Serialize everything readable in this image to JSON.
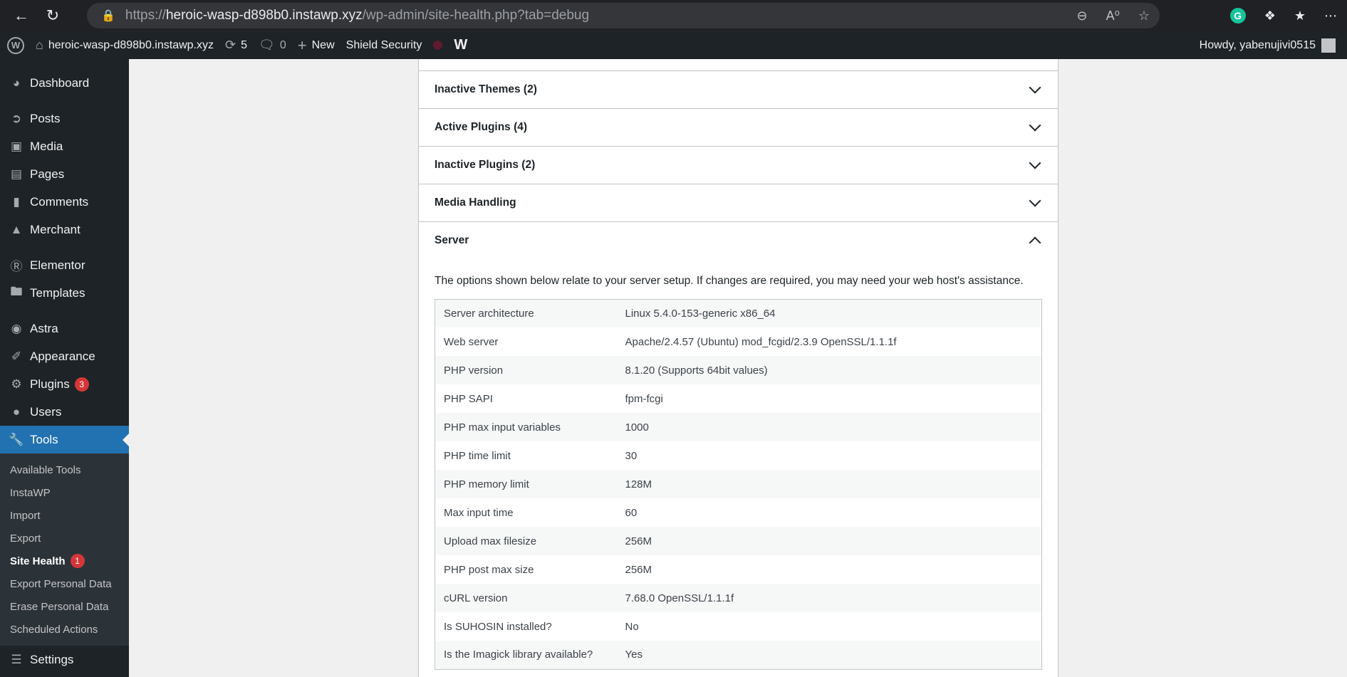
{
  "browser": {
    "url_prefix": "https://",
    "url_host": "heroic-wasp-d898b0.instawp.xyz",
    "url_path": "/wp-admin/site-health.php?tab=debug"
  },
  "adminbar": {
    "site_name": "heroic-wasp-d898b0.instawp.xyz",
    "updates_count": "5",
    "comments_count": "0",
    "new_label": "New",
    "shield_label": "Shield Security",
    "howdy": "Howdy, yabenujivi0515"
  },
  "sidebar": {
    "dashboard": "Dashboard",
    "posts": "Posts",
    "media": "Media",
    "pages": "Pages",
    "comments": "Comments",
    "merchant": "Merchant",
    "elementor": "Elementor",
    "templates": "Templates",
    "astra": "Astra",
    "appearance": "Appearance",
    "plugins": "Plugins",
    "plugins_badge": "3",
    "users": "Users",
    "tools": "Tools",
    "settings": "Settings",
    "tools_sub": {
      "available_tools": "Available Tools",
      "instawp": "InstaWP",
      "import": "Import",
      "export": "Export",
      "site_health": "Site Health",
      "site_health_badge": "1",
      "export_personal": "Export Personal Data",
      "erase_personal": "Erase Personal Data",
      "scheduled_actions": "Scheduled Actions"
    }
  },
  "accordions": {
    "inactive_themes": "Inactive Themes (2)",
    "active_plugins": "Active Plugins (4)",
    "inactive_plugins": "Inactive Plugins (2)",
    "media_handling": "Media Handling",
    "server": "Server"
  },
  "server": {
    "description": "The options shown below relate to your server setup. If changes are required, you may need your web host's assistance.",
    "rows": [
      {
        "k": "Server architecture",
        "v": "Linux 5.4.0-153-generic x86_64"
      },
      {
        "k": "Web server",
        "v": "Apache/2.4.57 (Ubuntu) mod_fcgid/2.3.9 OpenSSL/1.1.1f"
      },
      {
        "k": "PHP version",
        "v": "8.1.20 (Supports 64bit values)"
      },
      {
        "k": "PHP SAPI",
        "v": "fpm-fcgi"
      },
      {
        "k": "PHP max input variables",
        "v": "1000"
      },
      {
        "k": "PHP time limit",
        "v": "30"
      },
      {
        "k": "PHP memory limit",
        "v": "128M"
      },
      {
        "k": "Max input time",
        "v": "60"
      },
      {
        "k": "Upload max filesize",
        "v": "256M"
      },
      {
        "k": "PHP post max size",
        "v": "256M"
      },
      {
        "k": "cURL version",
        "v": "7.68.0 OpenSSL/1.1.1f"
      },
      {
        "k": "Is SUHOSIN installed?",
        "v": "No"
      },
      {
        "k": "Is the Imagick library available?",
        "v": "Yes"
      }
    ]
  }
}
